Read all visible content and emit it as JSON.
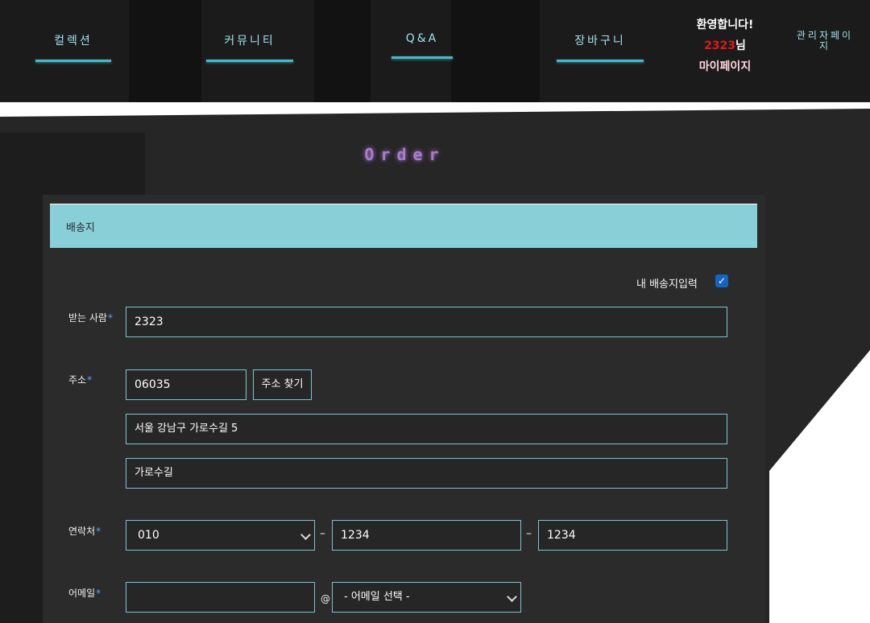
{
  "nav": {
    "items": [
      "컬렉션",
      "커뮤니티",
      "Q&A",
      "장바구니"
    ],
    "welcome": "환영합니다!",
    "username": "2323",
    "honorific": "님",
    "mypage": "마이페이지",
    "admin": "관리자페이지"
  },
  "page_title": "Order",
  "section": {
    "title": "배송지"
  },
  "my_address": {
    "label": "내 배송지입력",
    "checked": true
  },
  "form": {
    "sender": {
      "label": "받는 사람",
      "value": "2323"
    },
    "address": {
      "label": "주소",
      "zipcode": "06035",
      "search_button": "주소 찾기",
      "line1": "서울 강남구 가로수길 5",
      "line2": "가로수길"
    },
    "phone": {
      "label": "연락처",
      "part1": "010",
      "separator": "–",
      "part2": "1234",
      "part3": "1234"
    },
    "email": {
      "label": "어메일",
      "local": "",
      "at": "@",
      "domain_select": "- 어메일 선택 -"
    },
    "required_mark": "*"
  },
  "colors": {
    "accent_cyan": "#88cfd8",
    "nav_text": "#9fe3ea",
    "title_purple": "#a77fc5",
    "username_red": "#e01818",
    "checkbox_blue": "#1565c0"
  }
}
